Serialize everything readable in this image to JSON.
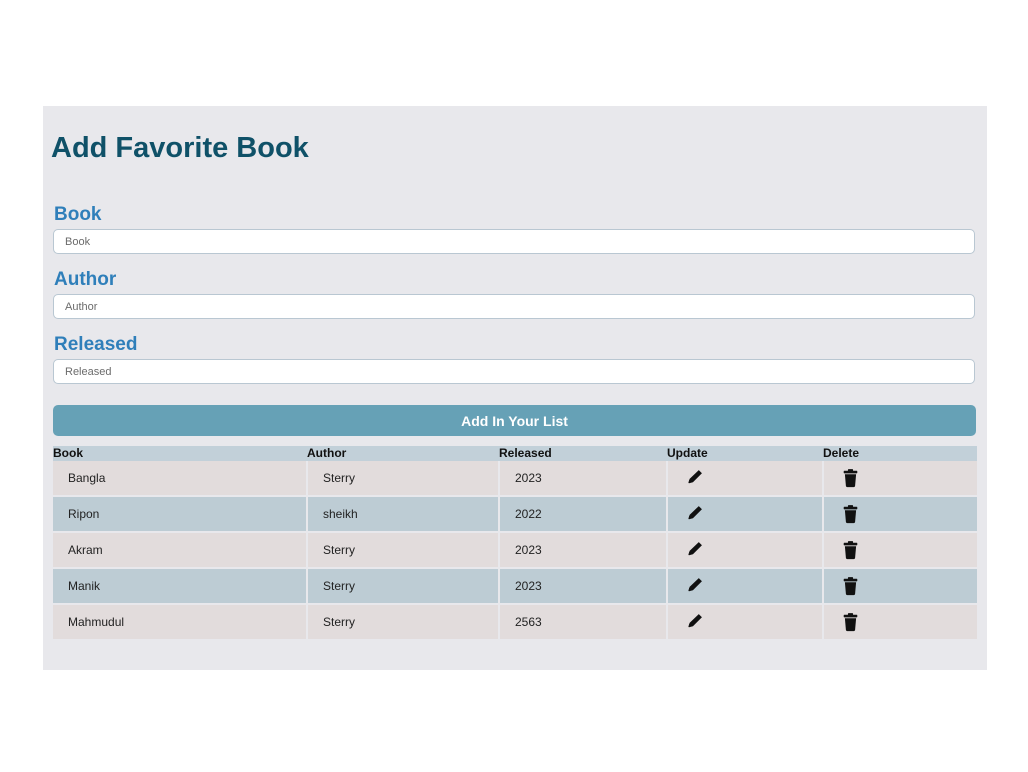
{
  "form": {
    "title": "Add Favorite Book",
    "book_label": "Book",
    "book_placeholder": "Book",
    "book_value": "",
    "author_label": "Author",
    "author_placeholder": "Author",
    "author_value": "",
    "released_label": "Released",
    "released_placeholder": "Released",
    "released_value": "",
    "submit_label": "Add In Your List"
  },
  "table": {
    "headers": [
      "Book",
      "Author",
      "Released",
      "Update",
      "Delete"
    ],
    "rows": [
      {
        "book": "Bangla",
        "author": "Sterry",
        "released": "2023"
      },
      {
        "book": "Ripon",
        "author": "sheikh",
        "released": "2022"
      },
      {
        "book": "Akram",
        "author": "Sterry",
        "released": "2023"
      },
      {
        "book": "Manik",
        "author": "Sterry",
        "released": "2023"
      },
      {
        "book": "Mahmudul",
        "author": "Sterry",
        "released": "2563"
      }
    ],
    "update_icon": "pencil-icon",
    "delete_icon": "trash-icon"
  },
  "colors": {
    "title": "#0f5168",
    "label": "#2f7fba",
    "button": "#66a1b6",
    "row_odd": "#e2dcdc",
    "row_even": "#bdccd4"
  }
}
